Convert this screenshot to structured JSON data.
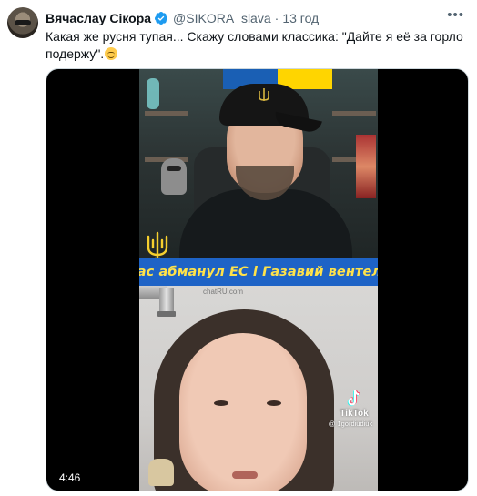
{
  "tweet": {
    "display_name": "Вячаслау Сікора",
    "verified": true,
    "handle": "@SIKORA_slava",
    "separator": "·",
    "time": "13 год",
    "more_icon": "ellipsis-icon",
    "text": "Какая же русня тупая... Скажу словами классика: \"Дайте я её за горло подержу\".",
    "text_emoji": "relieved-face-emoji"
  },
  "media": {
    "banner_text": "Вас абманул ЕС і Газавий вентель",
    "watermark": "chatRU.com",
    "tiktok_brand": "TikTok",
    "tiktok_user": "@ 1gordiudiuk",
    "duration": "4:46"
  },
  "colors": {
    "verified_badge": "#1d9bf0",
    "banner_bg": "#1e63c6",
    "banner_text": "#ffe24a",
    "secondary_text": "#536471"
  }
}
